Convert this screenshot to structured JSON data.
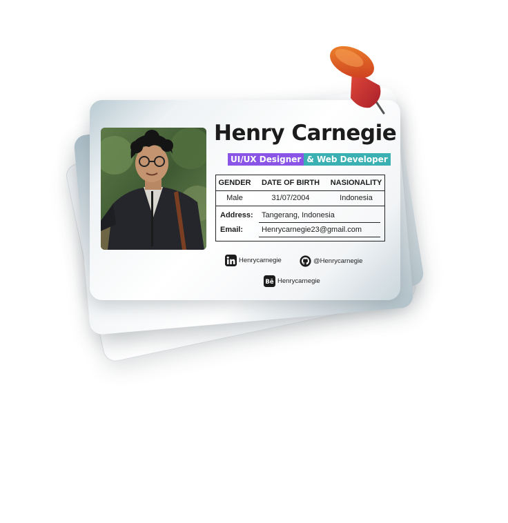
{
  "name": "Henry Carnegie",
  "roles": [
    "UI/UX Designer",
    "& Web Developer"
  ],
  "table": {
    "headers": [
      "GENDER",
      "DATE OF BIRTH",
      "NASIONALITY"
    ],
    "values": [
      "Male",
      "31/07/2004",
      "Indonesia"
    ]
  },
  "fields": {
    "address_label": "Address:",
    "address_value": "Tangerang, Indonesia",
    "email_label": "Email:",
    "email_value": "Henrycarnegie23@gmail.com"
  },
  "social": {
    "linkedin": "Henrycarnegie",
    "github": "@Henrycarnegie",
    "behance": "Henrycarnegie"
  },
  "colors": {
    "role1": "#8a55e6",
    "role2": "#3bb0b2",
    "pin": "#d9452e"
  },
  "icons": [
    "linkedin-icon",
    "github-icon",
    "behance-icon",
    "push-pin-icon"
  ]
}
